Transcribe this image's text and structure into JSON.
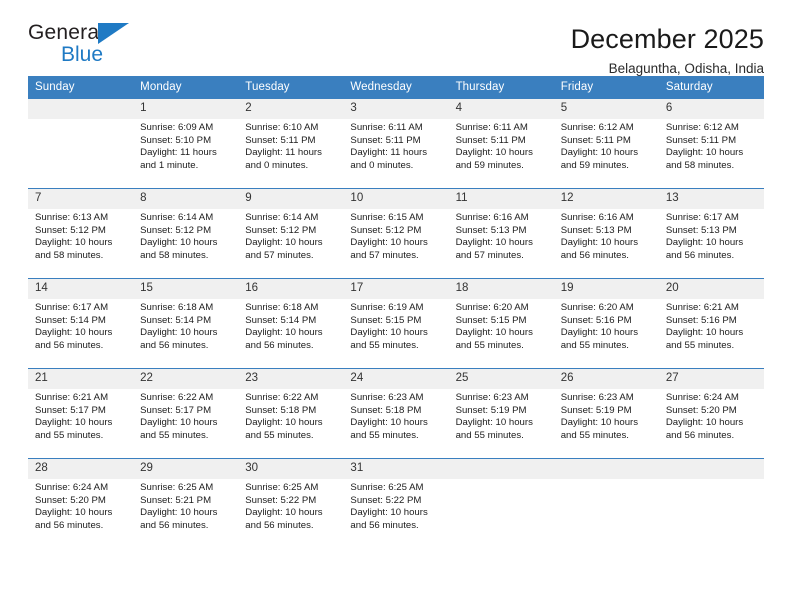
{
  "brand": {
    "name_top": "General",
    "name_bottom": "Blue",
    "triangle_icon": "triangle-icon",
    "accent_color": "#1f7ac4"
  },
  "header": {
    "title": "December 2025",
    "subtitle": "Belaguntha, Odisha, India"
  },
  "calendar": {
    "header_bg": "#3a7fbf",
    "daynum_bg": "#f0f0f0",
    "weekday_headers": [
      "Sunday",
      "Monday",
      "Tuesday",
      "Wednesday",
      "Thursday",
      "Friday",
      "Saturday"
    ],
    "weeks": [
      [
        {
          "day": "",
          "sunrise": "",
          "sunset": "",
          "daylight": ""
        },
        {
          "day": "1",
          "sunrise": "Sunrise: 6:09 AM",
          "sunset": "Sunset: 5:10 PM",
          "daylight": "Daylight: 11 hours and 1 minute."
        },
        {
          "day": "2",
          "sunrise": "Sunrise: 6:10 AM",
          "sunset": "Sunset: 5:11 PM",
          "daylight": "Daylight: 11 hours and 0 minutes."
        },
        {
          "day": "3",
          "sunrise": "Sunrise: 6:11 AM",
          "sunset": "Sunset: 5:11 PM",
          "daylight": "Daylight: 11 hours and 0 minutes."
        },
        {
          "day": "4",
          "sunrise": "Sunrise: 6:11 AM",
          "sunset": "Sunset: 5:11 PM",
          "daylight": "Daylight: 10 hours and 59 minutes."
        },
        {
          "day": "5",
          "sunrise": "Sunrise: 6:12 AM",
          "sunset": "Sunset: 5:11 PM",
          "daylight": "Daylight: 10 hours and 59 minutes."
        },
        {
          "day": "6",
          "sunrise": "Sunrise: 6:12 AM",
          "sunset": "Sunset: 5:11 PM",
          "daylight": "Daylight: 10 hours and 58 minutes."
        }
      ],
      [
        {
          "day": "7",
          "sunrise": "Sunrise: 6:13 AM",
          "sunset": "Sunset: 5:12 PM",
          "daylight": "Daylight: 10 hours and 58 minutes."
        },
        {
          "day": "8",
          "sunrise": "Sunrise: 6:14 AM",
          "sunset": "Sunset: 5:12 PM",
          "daylight": "Daylight: 10 hours and 58 minutes."
        },
        {
          "day": "9",
          "sunrise": "Sunrise: 6:14 AM",
          "sunset": "Sunset: 5:12 PM",
          "daylight": "Daylight: 10 hours and 57 minutes."
        },
        {
          "day": "10",
          "sunrise": "Sunrise: 6:15 AM",
          "sunset": "Sunset: 5:12 PM",
          "daylight": "Daylight: 10 hours and 57 minutes."
        },
        {
          "day": "11",
          "sunrise": "Sunrise: 6:16 AM",
          "sunset": "Sunset: 5:13 PM",
          "daylight": "Daylight: 10 hours and 57 minutes."
        },
        {
          "day": "12",
          "sunrise": "Sunrise: 6:16 AM",
          "sunset": "Sunset: 5:13 PM",
          "daylight": "Daylight: 10 hours and 56 minutes."
        },
        {
          "day": "13",
          "sunrise": "Sunrise: 6:17 AM",
          "sunset": "Sunset: 5:13 PM",
          "daylight": "Daylight: 10 hours and 56 minutes."
        }
      ],
      [
        {
          "day": "14",
          "sunrise": "Sunrise: 6:17 AM",
          "sunset": "Sunset: 5:14 PM",
          "daylight": "Daylight: 10 hours and 56 minutes."
        },
        {
          "day": "15",
          "sunrise": "Sunrise: 6:18 AM",
          "sunset": "Sunset: 5:14 PM",
          "daylight": "Daylight: 10 hours and 56 minutes."
        },
        {
          "day": "16",
          "sunrise": "Sunrise: 6:18 AM",
          "sunset": "Sunset: 5:14 PM",
          "daylight": "Daylight: 10 hours and 56 minutes."
        },
        {
          "day": "17",
          "sunrise": "Sunrise: 6:19 AM",
          "sunset": "Sunset: 5:15 PM",
          "daylight": "Daylight: 10 hours and 55 minutes."
        },
        {
          "day": "18",
          "sunrise": "Sunrise: 6:20 AM",
          "sunset": "Sunset: 5:15 PM",
          "daylight": "Daylight: 10 hours and 55 minutes."
        },
        {
          "day": "19",
          "sunrise": "Sunrise: 6:20 AM",
          "sunset": "Sunset: 5:16 PM",
          "daylight": "Daylight: 10 hours and 55 minutes."
        },
        {
          "day": "20",
          "sunrise": "Sunrise: 6:21 AM",
          "sunset": "Sunset: 5:16 PM",
          "daylight": "Daylight: 10 hours and 55 minutes."
        }
      ],
      [
        {
          "day": "21",
          "sunrise": "Sunrise: 6:21 AM",
          "sunset": "Sunset: 5:17 PM",
          "daylight": "Daylight: 10 hours and 55 minutes."
        },
        {
          "day": "22",
          "sunrise": "Sunrise: 6:22 AM",
          "sunset": "Sunset: 5:17 PM",
          "daylight": "Daylight: 10 hours and 55 minutes."
        },
        {
          "day": "23",
          "sunrise": "Sunrise: 6:22 AM",
          "sunset": "Sunset: 5:18 PM",
          "daylight": "Daylight: 10 hours and 55 minutes."
        },
        {
          "day": "24",
          "sunrise": "Sunrise: 6:23 AM",
          "sunset": "Sunset: 5:18 PM",
          "daylight": "Daylight: 10 hours and 55 minutes."
        },
        {
          "day": "25",
          "sunrise": "Sunrise: 6:23 AM",
          "sunset": "Sunset: 5:19 PM",
          "daylight": "Daylight: 10 hours and 55 minutes."
        },
        {
          "day": "26",
          "sunrise": "Sunrise: 6:23 AM",
          "sunset": "Sunset: 5:19 PM",
          "daylight": "Daylight: 10 hours and 55 minutes."
        },
        {
          "day": "27",
          "sunrise": "Sunrise: 6:24 AM",
          "sunset": "Sunset: 5:20 PM",
          "daylight": "Daylight: 10 hours and 56 minutes."
        }
      ],
      [
        {
          "day": "28",
          "sunrise": "Sunrise: 6:24 AM",
          "sunset": "Sunset: 5:20 PM",
          "daylight": "Daylight: 10 hours and 56 minutes."
        },
        {
          "day": "29",
          "sunrise": "Sunrise: 6:25 AM",
          "sunset": "Sunset: 5:21 PM",
          "daylight": "Daylight: 10 hours and 56 minutes."
        },
        {
          "day": "30",
          "sunrise": "Sunrise: 6:25 AM",
          "sunset": "Sunset: 5:22 PM",
          "daylight": "Daylight: 10 hours and 56 minutes."
        },
        {
          "day": "31",
          "sunrise": "Sunrise: 6:25 AM",
          "sunset": "Sunset: 5:22 PM",
          "daylight": "Daylight: 10 hours and 56 minutes."
        },
        {
          "day": "",
          "sunrise": "",
          "sunset": "",
          "daylight": ""
        },
        {
          "day": "",
          "sunrise": "",
          "sunset": "",
          "daylight": ""
        },
        {
          "day": "",
          "sunrise": "",
          "sunset": "",
          "daylight": ""
        }
      ]
    ]
  }
}
